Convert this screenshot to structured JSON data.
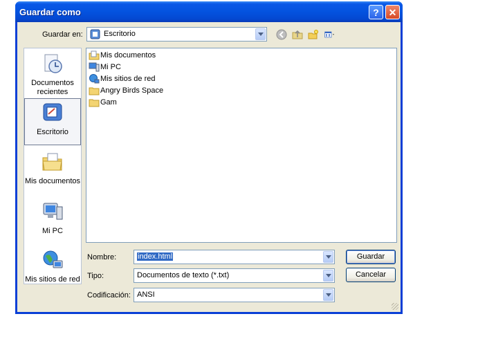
{
  "window": {
    "title": "Guardar como",
    "help_icon": "help-icon",
    "close_icon": "close-icon"
  },
  "save_in": {
    "label": "Guardar en:",
    "value": "Escritorio"
  },
  "toolbar": {
    "icons": [
      "back-icon",
      "up-folder-icon",
      "new-folder-icon",
      "views-menu-icon"
    ]
  },
  "places": [
    {
      "label": "Documentos recientes",
      "icon": "recent-documents-icon"
    },
    {
      "label": "Escritorio",
      "icon": "desktop-icon",
      "selected": true
    },
    {
      "label": "Mis documentos",
      "icon": "my-documents-icon"
    },
    {
      "label": "Mi PC",
      "icon": "my-computer-icon"
    },
    {
      "label": "Mis sitios de red",
      "icon": "network-places-icon"
    }
  ],
  "files": [
    {
      "name": "Mis documentos",
      "icon": "my-documents-icon"
    },
    {
      "name": "Mi PC",
      "icon": "my-computer-icon"
    },
    {
      "name": "Mis sitios de red",
      "icon": "network-places-icon"
    },
    {
      "name": "Angry Birds Space",
      "icon": "folder-icon"
    },
    {
      "name": "Gam",
      "icon": "folder-icon"
    }
  ],
  "filename": {
    "label": "Nombre:",
    "value": "index.html"
  },
  "filetype": {
    "label": "Tipo:",
    "value": "Documentos de texto (*.txt)"
  },
  "encoding": {
    "label": "Codificación:",
    "value": "ANSI"
  },
  "buttons": {
    "save": "Guardar",
    "cancel": "Cancelar"
  },
  "colors": {
    "title_bar": "#0453df",
    "dialog_bg": "#ece9d8",
    "selection": "#316ac5"
  }
}
